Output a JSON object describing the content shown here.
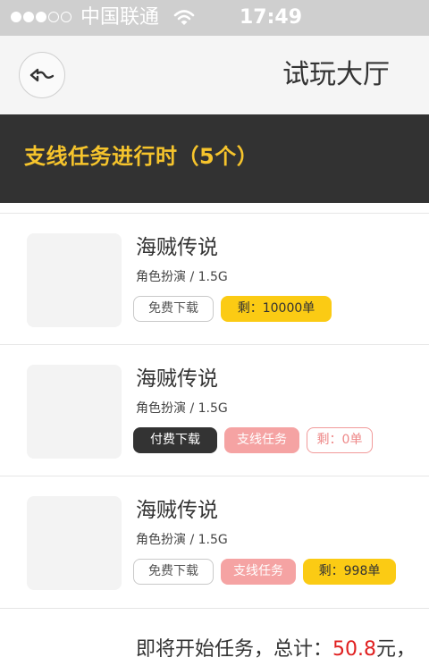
{
  "status_bar": {
    "carrier": "中国联通",
    "time": "17:49",
    "signal_filled": 3,
    "signal_total": 5
  },
  "nav": {
    "title": "试玩大厅",
    "back_icon": "back-arrow-icon"
  },
  "banner": {
    "text": "支线任务进行时（5个）"
  },
  "colors": {
    "accent_yellow": "#fbcb14",
    "banner_text": "#f6c42c",
    "dark": "#323232",
    "pink": "#f5a3a3",
    "amount_red": "#e02020"
  },
  "items": [
    {
      "name": "海贼传说",
      "meta": "角色扮演 / 1.5G",
      "tags": [
        "免费下载",
        "剩：10000单"
      ]
    },
    {
      "name": "海贼传说",
      "meta": "角色扮演 / 1.5G",
      "tags": [
        "付费下载",
        "支线任务",
        "剩：0单"
      ]
    },
    {
      "name": "海贼传说",
      "meta": "角色扮演 / 1.5G",
      "tags": [
        "免费下载",
        "支线任务",
        "剩：998单"
      ]
    }
  ],
  "footer": {
    "prefix": "即将开始任务，总计：",
    "amount": "50.8",
    "suffix": "元，"
  }
}
